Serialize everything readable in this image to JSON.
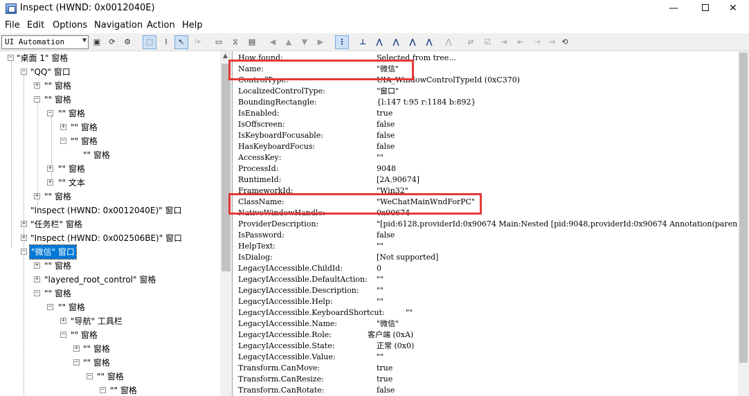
{
  "window": {
    "title": "Inspect  (HWND: 0x0012040E)",
    "controls": {
      "minimize": "—",
      "close": "✕"
    }
  },
  "menu": [
    "File",
    "Edit",
    "Options",
    "Navigation",
    "Action",
    "Help"
  ],
  "toolbar": {
    "mode_select": "UI Automation",
    "icons": [
      "copy-icon",
      "refresh-icon",
      "settings-icon",
      "watch-focus-icon",
      "text-cursor-icon",
      "watch-cursor-icon",
      "hover-icon",
      "highlight-icon",
      "hourglass-icon",
      "caret-icon",
      "nav-left-icon",
      "nav-up-icon",
      "nav-down-icon",
      "nav-right-icon",
      "tree-view-icon",
      "nav-parent-icon",
      "nav-first-child-icon",
      "nav-prev-sibling-icon",
      "nav-next-sibling-icon",
      "nav-last-child-icon",
      "nav-disabled-icon",
      "action-1-icon",
      "action-2-icon",
      "action-3-icon",
      "action-4-icon",
      "action-5-icon",
      "refresh-view-icon"
    ]
  },
  "tree": [
    {
      "label": "\"桌面 1\" 窗格",
      "expander": "−"
    },
    {
      "label": "\"QQ\" 窗口",
      "expander": "−"
    },
    {
      "label": "\"\" 窗格",
      "expander": "+"
    },
    {
      "label": "\"\" 窗格",
      "expander": "−"
    },
    {
      "label": "\"\" 窗格",
      "expander": "−"
    },
    {
      "label": "\"\" 窗格",
      "expander": "+"
    },
    {
      "label": "\"\" 窗格",
      "expander": "−"
    },
    {
      "label": "\"\" 窗格",
      "expander": ""
    },
    {
      "label": "\"\" 窗格",
      "expander": "+"
    },
    {
      "label": "\"\" 文本",
      "expander": "+"
    },
    {
      "label": "\"\" 窗格",
      "expander": "+"
    },
    {
      "label": "\"Inspect  (HWND: 0x0012040E)\" 窗口",
      "expander": ""
    },
    {
      "label": "\"任务栏\" 窗格",
      "expander": "+"
    },
    {
      "label": "\"Inspect  (HWND: 0x002506BE)\" 窗口",
      "expander": "+"
    },
    {
      "label": "\"微信\" 窗口",
      "expander": "−",
      "selected": true
    },
    {
      "label": "\"\" 窗格",
      "expander": "+"
    },
    {
      "label": "\"layered_root_control\" 窗格",
      "expander": "+"
    },
    {
      "label": "\"\" 窗格",
      "expander": "−"
    },
    {
      "label": "\"\" 窗格",
      "expander": "−"
    },
    {
      "label": "\"导航\" 工具栏",
      "expander": "+"
    },
    {
      "label": "\"\" 窗格",
      "expander": "−"
    },
    {
      "label": "\"\" 窗格",
      "expander": "+"
    },
    {
      "label": "\"\" 窗格",
      "expander": "−"
    },
    {
      "label": "\"\" 窗格",
      "expander": "−"
    },
    {
      "label": "\"\" 窗格",
      "expander": "−"
    }
  ],
  "properties": [
    {
      "name": "How found:",
      "value": "Selected from tree..."
    },
    {
      "name": "Name:",
      "value": "\"微信\""
    },
    {
      "name": "ControlType:",
      "value": "UIA_WindowControlTypeId (0xC370)"
    },
    {
      "name": "LocalizedControlType:",
      "value": "\"窗口\""
    },
    {
      "name": "BoundingRectangle:",
      "value": "{l:147 t:95 r:1184 b:892}"
    },
    {
      "name": "IsEnabled:",
      "value": "true"
    },
    {
      "name": "IsOffscreen:",
      "value": "false"
    },
    {
      "name": "IsKeyboardFocusable:",
      "value": "false"
    },
    {
      "name": "HasKeyboardFocus:",
      "value": "false"
    },
    {
      "name": "AccessKey:",
      "value": "\"\""
    },
    {
      "name": "ProcessId:",
      "value": "9048"
    },
    {
      "name": "RuntimeId:",
      "value": "[2A.90674]"
    },
    {
      "name": "FrameworkId:",
      "value": "\"Win32\""
    },
    {
      "name": "ClassName:",
      "value": "\"WeChatMainWndForPC\""
    },
    {
      "name": "NativeWindowHandle:",
      "value": "0x90674"
    },
    {
      "name": "ProviderDescription:",
      "value": "\"[pid:6128,providerId:0x90674 Main:Nested [pid:9048,providerId:0x90674 Annotation(paren"
    },
    {
      "name": "IsPassword:",
      "value": "false"
    },
    {
      "name": "HelpText:",
      "value": "\"\""
    },
    {
      "name": "IsDialog:",
      "value": "[Not supported]"
    },
    {
      "name": "LegacyIAccessible.ChildId:",
      "value": "0"
    },
    {
      "name": "LegacyIAccessible.DefaultAction:",
      "value": "\"\""
    },
    {
      "name": "LegacyIAccessible.Description:",
      "value": "\"\""
    },
    {
      "name": "LegacyIAccessible.Help:",
      "value": "\"\""
    },
    {
      "name": "LegacyIAccessible.KeyboardShortcut:",
      "value": "\"\""
    },
    {
      "name": "LegacyIAccessible.Name:",
      "value": "\"微信\""
    },
    {
      "name": "LegacyIAccessible.Role:",
      "value": "客户端 (0xA)"
    },
    {
      "name": "LegacyIAccessible.State:",
      "value": "正常 (0x0)"
    },
    {
      "name": "LegacyIAccessible.Value:",
      "value": "\"\""
    },
    {
      "name": "Transform.CanMove:",
      "value": "true"
    },
    {
      "name": "Transform.CanResize:",
      "value": "true"
    },
    {
      "name": "Transform.CanRotate:",
      "value": "false"
    }
  ],
  "colors": {
    "selection": "#0078d7",
    "highlight_box": "#e53935"
  }
}
